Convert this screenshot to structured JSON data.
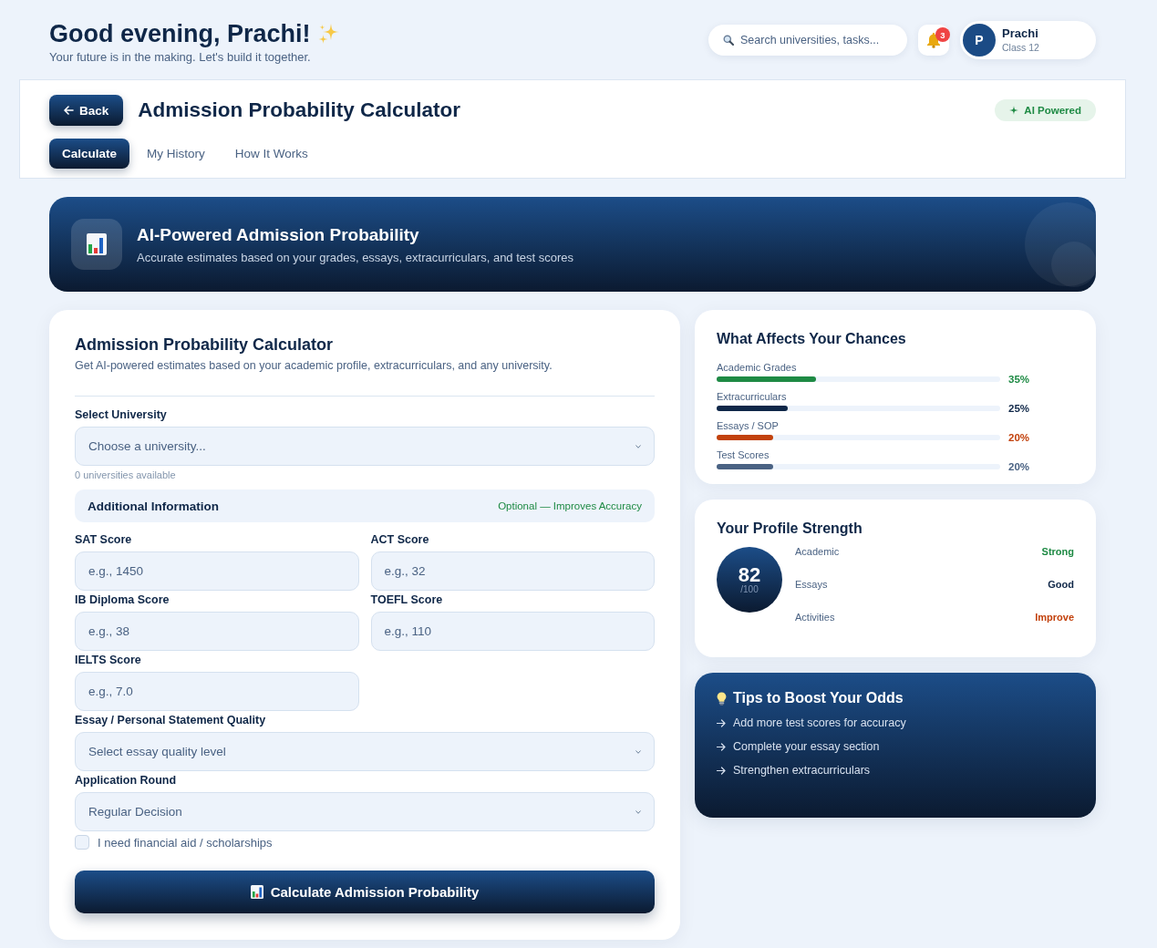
{
  "header": {
    "greeting": "Good evening, Prachi!",
    "tagline": "Your future is in the making. Let's build it together.",
    "search": {
      "placeholder": "Search universities, tasks..."
    },
    "notifications": {
      "count": "3"
    },
    "profile": {
      "initial": "P",
      "name": "Prachi",
      "subtitle": "Class 12"
    }
  },
  "toolbar": {
    "back_button": "Back",
    "title": "Admission Probability Calculator",
    "badge": "AI Powered",
    "tabs": [
      {
        "label": "Calculate",
        "selected": true
      },
      {
        "label": "My History",
        "selected": false
      },
      {
        "label": "How It Works",
        "selected": false
      }
    ]
  },
  "banner": {
    "title": "AI-Powered Admission Probability",
    "subtitle": "Accurate estimates based on your grades, essays, extracurriculars, and test scores"
  },
  "calculator": {
    "title": "Admission Probability Calculator",
    "subtitle": "Get AI-powered estimates based on your academic profile, extracurriculars, and any university.",
    "university": {
      "label": "Select University",
      "placeholder": "Choose a university...",
      "hint": "0 universities available"
    },
    "additional_info": {
      "title": "Additional Information",
      "note": "Optional — Improves Accuracy"
    },
    "scores": [
      {
        "label": "SAT Score",
        "placeholder": "e.g., 1450"
      },
      {
        "label": "ACT Score",
        "placeholder": "e.g., 32"
      },
      {
        "label": "IB Diploma Score",
        "placeholder": "e.g., 38"
      },
      {
        "label": "TOEFL Score",
        "placeholder": "e.g., 110"
      },
      {
        "label": "IELTS Score",
        "placeholder": "e.g., 7.0"
      }
    ],
    "essay_quality": {
      "label": "Essay / Personal Statement Quality",
      "placeholder": "Select essay quality level"
    },
    "application_round": {
      "label": "Application Round",
      "value": "Regular Decision"
    },
    "financial_aid": {
      "label": "I need financial aid / scholarships",
      "checked": false
    },
    "submit_button": "Calculate Admission Probability"
  },
  "factors_card": {
    "title": "What Affects Your Chances",
    "factors": [
      {
        "name": "Academic Grades",
        "level": 0.35,
        "reading": "35%",
        "color": "#1e8a44"
      },
      {
        "name": "Extracurriculars",
        "level": 0.25,
        "reading": "25%",
        "color": "#0f2748"
      },
      {
        "name": "Essays / SOP",
        "level": 0.2,
        "reading": "20%",
        "color": "#c2410c"
      },
      {
        "name": "Test Scores",
        "level": 0.2,
        "reading": "20%",
        "color": "#4a6283"
      }
    ]
  },
  "profile_strength": {
    "title": "Your Profile Strength",
    "score": "82",
    "out_of": "/100",
    "areas": [
      {
        "name": "Academic",
        "rating": "Strong",
        "color": "#1e8a44"
      },
      {
        "name": "Essays",
        "rating": "Good",
        "color": "#0f2748"
      },
      {
        "name": "Activities",
        "rating": "Improve",
        "color": "#c2410c"
      }
    ]
  },
  "tips": {
    "title": "Tips to Boost Your Odds",
    "items": [
      "Add more test scores for accuracy",
      "Complete your essay section",
      "Strengthen extracurriculars"
    ]
  }
}
